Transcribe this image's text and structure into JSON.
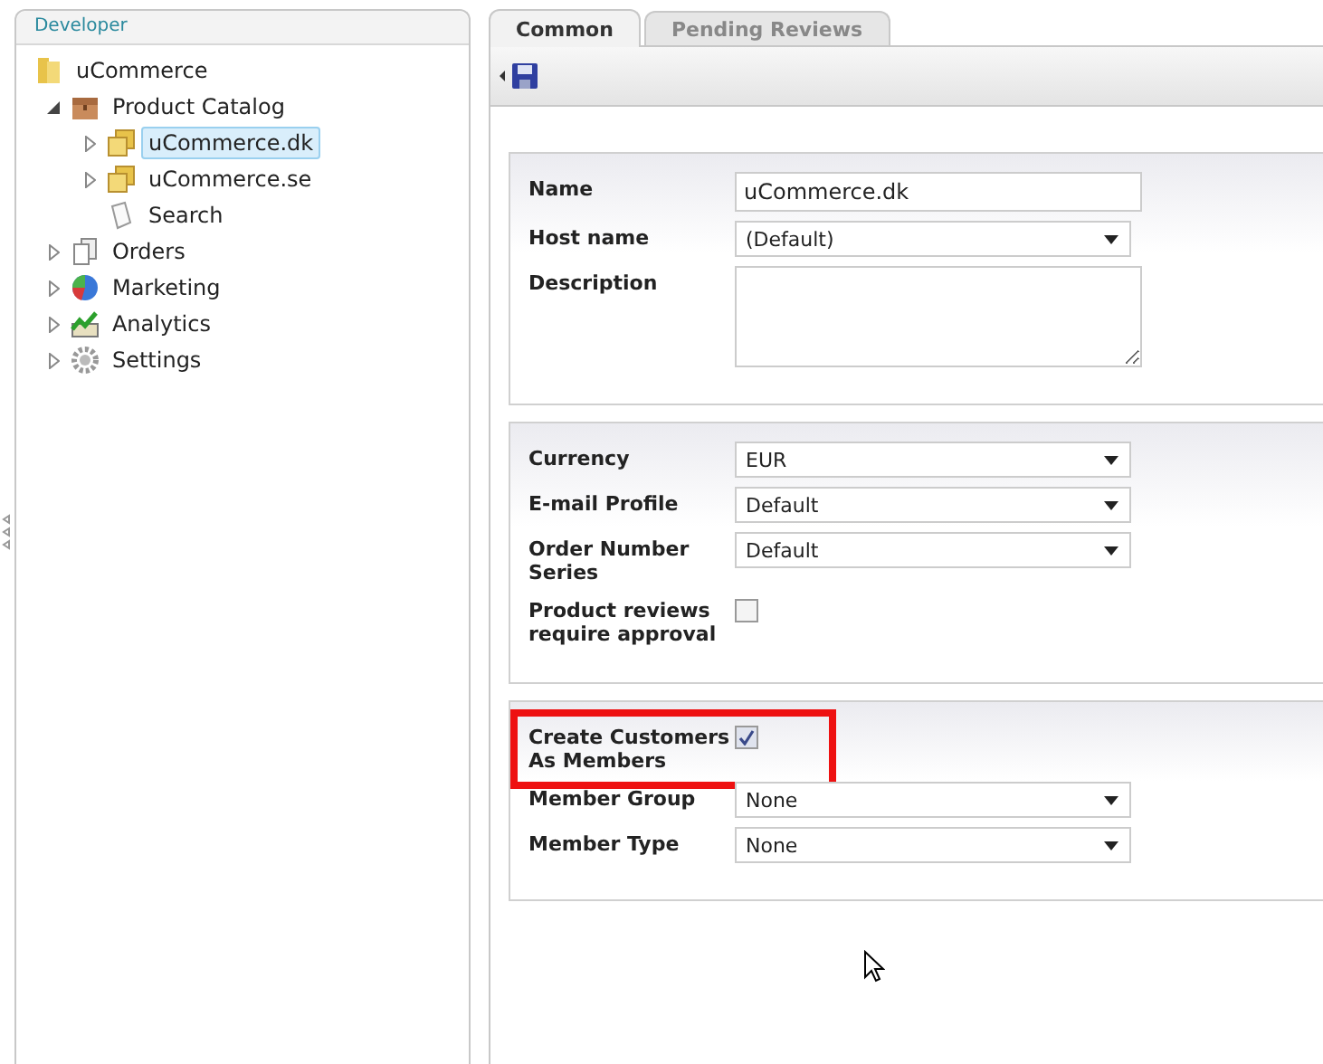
{
  "sidebar": {
    "title": "Developer",
    "tree": [
      {
        "label": "uCommerce",
        "kind": "folder",
        "selected": false,
        "children": [
          {
            "label": "Product Catalog",
            "kind": "box",
            "expanded": true,
            "selected": false,
            "children": [
              {
                "label": "uCommerce.dk",
                "kind": "folders",
                "expanded": false,
                "selected": true
              },
              {
                "label": "uCommerce.se",
                "kind": "folders",
                "expanded": false,
                "selected": false
              },
              {
                "label": "Search",
                "kind": "scroll",
                "selected": false
              }
            ]
          },
          {
            "label": "Orders",
            "kind": "documents",
            "expanded": false,
            "selected": false
          },
          {
            "label": "Marketing",
            "kind": "pie",
            "expanded": false,
            "selected": false
          },
          {
            "label": "Analytics",
            "kind": "chart",
            "expanded": false,
            "selected": false
          },
          {
            "label": "Settings",
            "kind": "gear",
            "expanded": false,
            "selected": false
          }
        ]
      }
    ]
  },
  "tabs": [
    {
      "label": "Common",
      "selected": true
    },
    {
      "label": "Pending Reviews",
      "selected": false
    }
  ],
  "sections": [
    {
      "fields": [
        {
          "label": "Name",
          "kind": "text",
          "value": "uCommerce.dk"
        },
        {
          "label": "Host name",
          "kind": "select",
          "value": "(Default)"
        },
        {
          "label": "Description",
          "kind": "textarea"
        }
      ]
    },
    {
      "fields": [
        {
          "label": "Currency",
          "kind": "select",
          "value": "EUR"
        },
        {
          "label": "E-mail Profile",
          "kind": "select",
          "value": "Default"
        },
        {
          "label": "Order Number Series",
          "kind": "select",
          "value": "Default"
        },
        {
          "label": "Product reviews require approval",
          "kind": "checkbox",
          "checked": false
        }
      ]
    },
    {
      "fields": [
        {
          "label": "Create Customers As Members",
          "kind": "checkbox",
          "checked": true,
          "highlighted": true
        },
        {
          "label": "Member Group",
          "kind": "select",
          "value": "None"
        },
        {
          "label": "Member Type",
          "kind": "select",
          "value": "None"
        }
      ]
    }
  ]
}
